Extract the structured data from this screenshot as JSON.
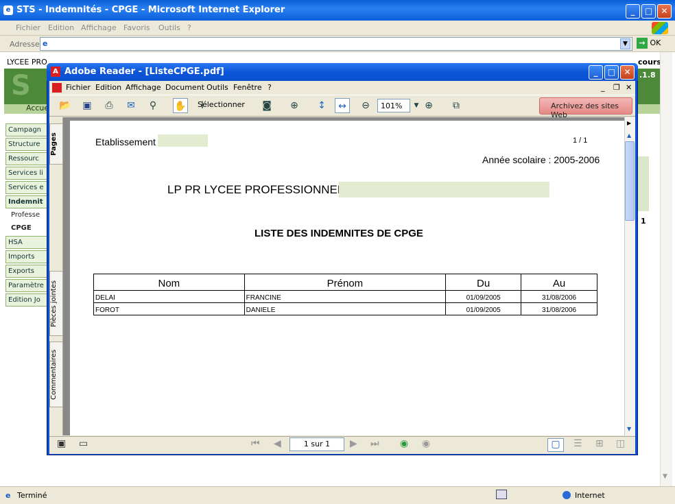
{
  "ie": {
    "title": "STS - Indemnités - CPGE - Microsoft Internet Explorer",
    "menu": [
      "Fichier",
      "Edition",
      "Affichage",
      "Favoris",
      "Outils",
      "?"
    ],
    "address_label": "Adresse",
    "go_label": "OK",
    "status_left": "Terminé",
    "status_zone": "Internet"
  },
  "background_page": {
    "school_label": "LYCEE PRO",
    "top_right": "cours",
    "version": ".1.8",
    "accueil": "Accue",
    "sidebar": [
      {
        "label": "Campagn",
        "style": "box"
      },
      {
        "label": "Structure",
        "style": "box"
      },
      {
        "label": "Ressourc",
        "style": "box"
      },
      {
        "label": "Services li",
        "style": "box"
      },
      {
        "label": "Services e",
        "style": "box"
      },
      {
        "label": "Indemnit",
        "style": "box-bold"
      },
      {
        "label": "Professe",
        "style": "plain"
      },
      {
        "label": "CPGE",
        "style": "plain-bold"
      },
      {
        "label": "HSA",
        "style": "box"
      },
      {
        "label": "Imports",
        "style": "box"
      },
      {
        "label": "Exports",
        "style": "box"
      },
      {
        "label": "Paramètre",
        "style": "box"
      },
      {
        "label": "Edition Jo",
        "style": "box"
      }
    ],
    "right_number": "1"
  },
  "reader": {
    "title": "Adobe Reader - [ListeCPGE.pdf]",
    "menu": [
      "Fichier",
      "Edition",
      "Affichage",
      "Document",
      "Outils",
      "Fenêtre",
      "?"
    ],
    "select_label": "Sélectionner",
    "zoom": "101%",
    "archive_label": "Archivez des sites Web",
    "tabs": [
      "Pages",
      "Pièces jointes",
      "Commentaires"
    ],
    "page_indicator": "1 sur 1"
  },
  "document": {
    "etablissement_label": "Etablissement :",
    "page_count": "1 / 1",
    "annee": "Année scolaire : 2005-2006",
    "school": "LP PR LYCEE PROFESSIONNEL",
    "heading": "LISTE DES INDEMNITES DE CPGE",
    "columns": [
      "Nom",
      "Prénom",
      "Du",
      "Au"
    ],
    "rows": [
      [
        "DELAI",
        "FRANCINE",
        "01/09/2005",
        "31/08/2006"
      ],
      [
        "FOROT",
        "DANIELE",
        "01/09/2005",
        "31/08/2006"
      ]
    ]
  }
}
